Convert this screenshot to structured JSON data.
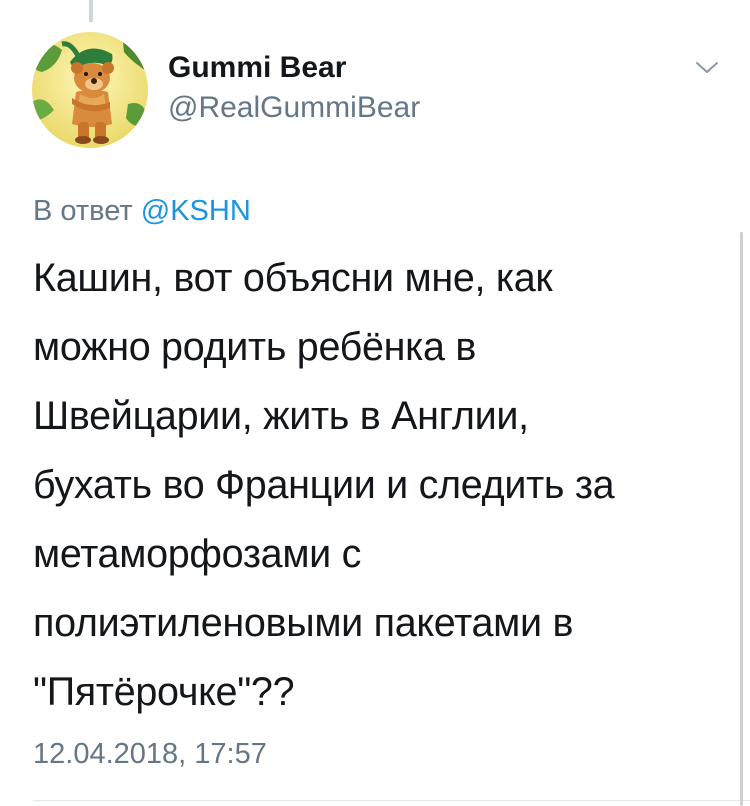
{
  "tweet": {
    "author": {
      "display_name": "Gummi Bear",
      "handle": "@RealGummiBear",
      "avatar_icon": "gummi-bear-avatar"
    },
    "reply_prefix": "В ответ ",
    "reply_mention": "@KSHN",
    "text_lines": [
      "Кашин, вот объясни мне, как",
      "можно родить ребёнка в",
      "Швейцарии, жить в Англии,",
      "бухать во Франции и следить за",
      "метаморфозами с",
      "полиэтиленовыми пакетами в",
      "\"Пятёрочке\"??"
    ],
    "timestamp": "12.04.2018, 17:57",
    "menu_icon": "chevron-down-icon"
  },
  "colors": {
    "text": "#14171a",
    "secondary": "#657786",
    "link": "#1b95e0",
    "divider": "#e1e8ed"
  }
}
